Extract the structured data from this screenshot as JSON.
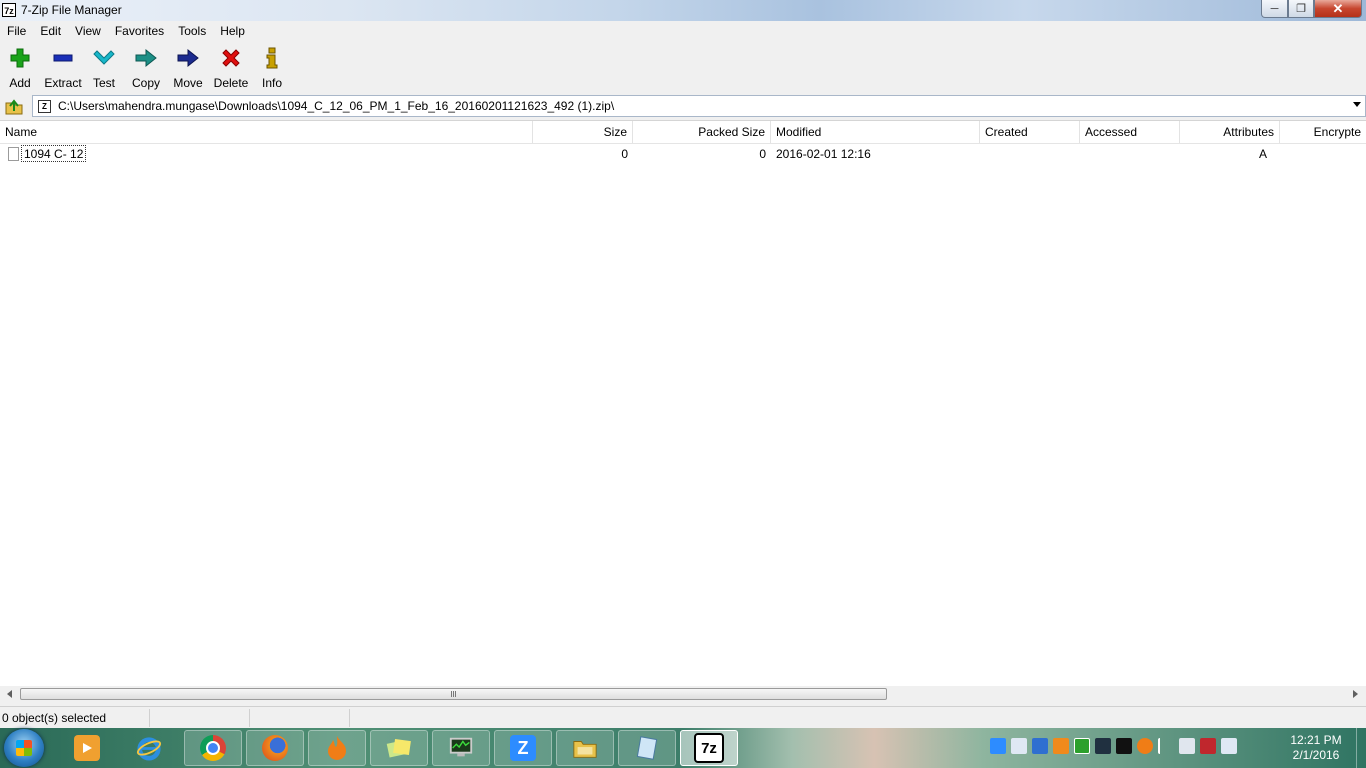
{
  "window": {
    "icon_text": "7z",
    "title": "7-Zip File Manager"
  },
  "menu": [
    "File",
    "Edit",
    "View",
    "Favorites",
    "Tools",
    "Help"
  ],
  "toolbar": {
    "add": "Add",
    "extract": "Extract",
    "test": "Test",
    "copy": "Copy",
    "move": "Move",
    "delete": "Delete",
    "info": "Info"
  },
  "address": {
    "icon_text": "Z",
    "path": "C:\\Users\\mahendra.mungase\\Downloads\\1094_C_12_06_PM_1_Feb_16_20160201121623_492 (1).zip\\"
  },
  "columns": {
    "name": "Name",
    "size": "Size",
    "packed_size": "Packed Size",
    "modified": "Modified",
    "created": "Created",
    "accessed": "Accessed",
    "attributes": "Attributes",
    "encrypted": "Encrypte"
  },
  "files": [
    {
      "name": "1094 C- 12",
      "size": "0",
      "packed_size": "0",
      "modified": "2016-02-01 12:16",
      "created": "",
      "accessed": "",
      "attributes": "A",
      "encrypted": ""
    }
  ],
  "status": {
    "selected": "0 object(s) selected"
  },
  "taskbar": {
    "zoom_letter": "Z",
    "sevenzip_letter": "7z",
    "clock_time": "12:21 PM",
    "clock_date": "2/1/2016"
  },
  "colors": {
    "add_icon": "#1aa31a",
    "extract_icon": "#1a2fb8",
    "test_icon": "#18b7c9",
    "copy_icon": "#1c8f86",
    "move_icon": "#1c2b8f",
    "delete_icon": "#e01010",
    "info_icon": "#c8a000"
  }
}
